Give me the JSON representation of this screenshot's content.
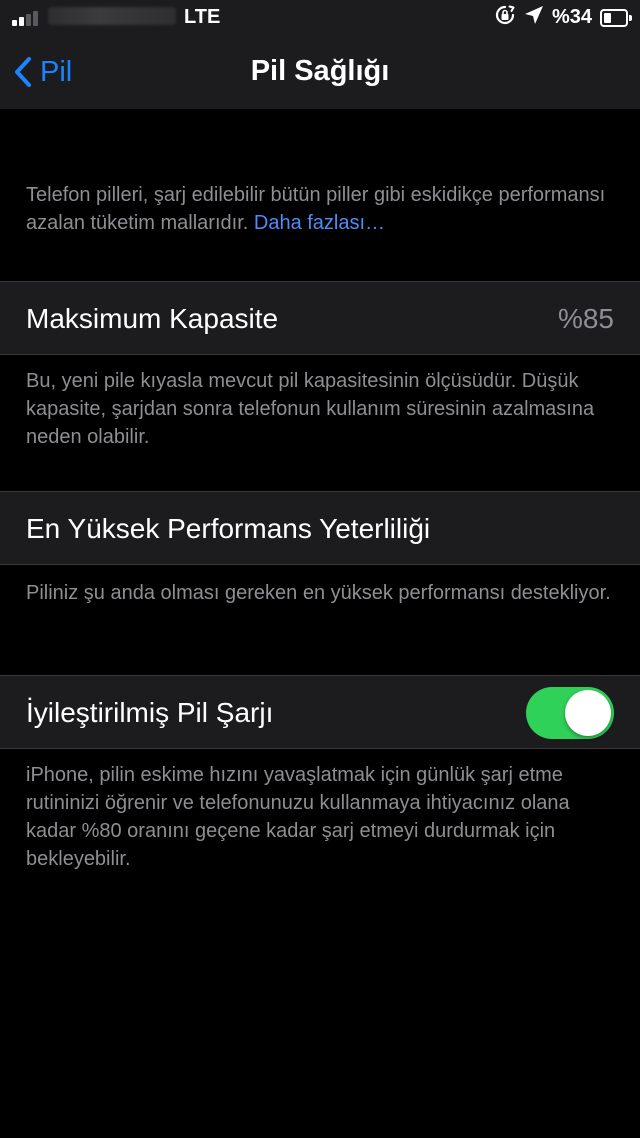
{
  "status_bar": {
    "network": "LTE",
    "battery_percent": "%34",
    "battery_level": 0.34,
    "signal_bars": 2,
    "icons": [
      "orientation-lock-icon",
      "location-arrow-icon",
      "battery-icon"
    ]
  },
  "nav": {
    "back_label": "Pil",
    "title": "Pil Sağlığı"
  },
  "intro": {
    "text": "Telefon pilleri, şarj edilebilir bütün piller gibi eskidikçe performansı azalan tüketim mallarıdır. ",
    "link": "Daha fazlası…"
  },
  "max_capacity": {
    "label": "Maksimum Kapasite",
    "value": "%85",
    "footer": "Bu, yeni pile kıyasla mevcut pil kapasitesinin ölçüsüdür. Düşük kapasite, şarjdan sonra telefonun kullanım süresinin azalmasına neden olabilir."
  },
  "peak_performance": {
    "label": "En Yüksek Performans Yeterliliği",
    "footer": "Piliniz şu anda olması gereken en yüksek performansı destekliyor."
  },
  "optimized_charging": {
    "label": "İyileştirilmiş Pil Şarjı",
    "enabled": true,
    "footer": "iPhone, pilin eskime hızını yavaşlatmak için günlük şarj etme rutininizi öğrenir ve telefonunuzu kullanmaya ihtiyacınız olana kadar %80 oranını geçene kadar şarj etmeyi durdurmak için bekleyebilir."
  },
  "colors": {
    "accent": "#1a84ff",
    "link": "#4f8cf7",
    "toggle_on": "#30d158",
    "secondary_text": "#8e8e93",
    "cell_background": "#1c1c1e",
    "page_background": "#000000"
  }
}
